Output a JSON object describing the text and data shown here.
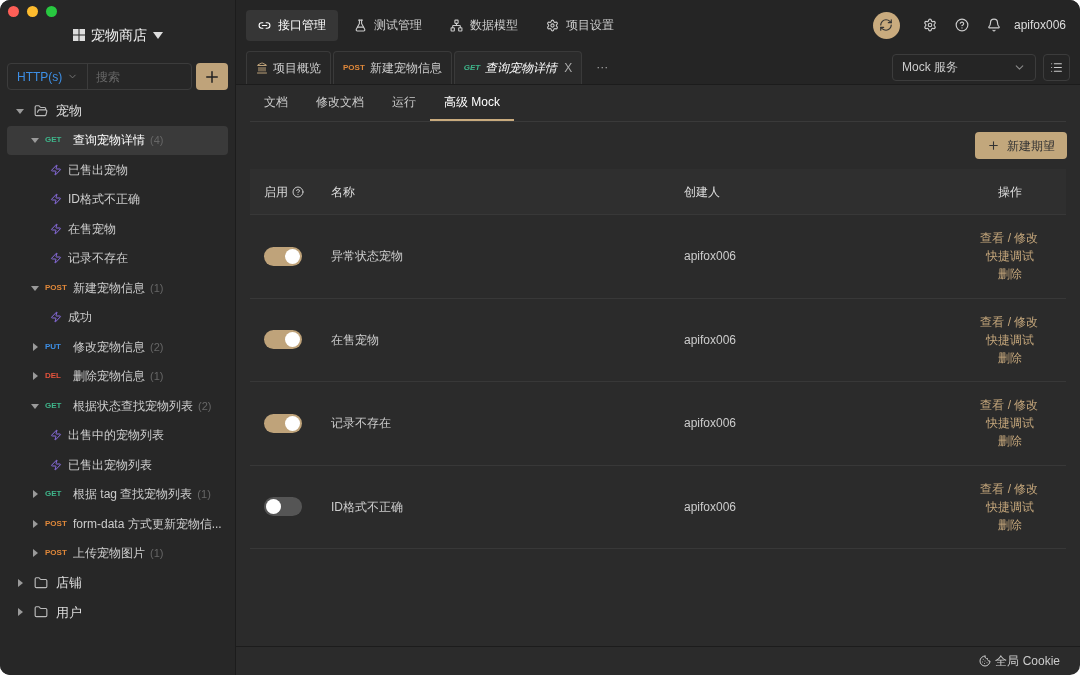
{
  "project": {
    "title": "宠物商店"
  },
  "sidebar": {
    "protocol": "HTTP(s)",
    "search": {
      "placeholder": "搜索"
    },
    "tree": [
      {
        "kind": "folder",
        "name": "宠物",
        "expanded": true,
        "children": [
          {
            "kind": "endpoint",
            "method": "GET",
            "name": "查询宠物详情",
            "count": "(4)",
            "expanded": true,
            "selected": true,
            "children": [
              {
                "kind": "mock",
                "name": "已售出宠物",
                "selected": false
              },
              {
                "kind": "mock",
                "name": "ID格式不正确",
                "selected": false
              },
              {
                "kind": "mock",
                "name": "在售宠物",
                "selected": false
              },
              {
                "kind": "mock",
                "name": "记录不存在",
                "selected": false
              }
            ]
          },
          {
            "kind": "endpoint",
            "method": "POST",
            "name": "新建宠物信息",
            "count": "(1)",
            "expanded": true,
            "selected": false,
            "children": [
              {
                "kind": "mock",
                "name": "成功",
                "selected": false
              }
            ]
          },
          {
            "kind": "endpoint",
            "method": "PUT",
            "name": "修改宠物信息",
            "count": "(2)",
            "expanded": false,
            "selected": false
          },
          {
            "kind": "endpoint",
            "method": "DEL",
            "name": "删除宠物信息",
            "count": "(1)",
            "expanded": false,
            "selected": false
          },
          {
            "kind": "endpoint",
            "method": "GET",
            "name": "根据状态查找宠物列表",
            "count": "(2)",
            "expanded": true,
            "selected": false,
            "children": [
              {
                "kind": "mock",
                "name": "出售中的宠物列表",
                "selected": false
              },
              {
                "kind": "mock",
                "name": "已售出宠物列表",
                "selected": false
              }
            ]
          },
          {
            "kind": "endpoint",
            "method": "GET",
            "name": "根据 tag 查找宠物列表",
            "count": "(1)",
            "expanded": false,
            "selected": false
          },
          {
            "kind": "endpoint",
            "method": "POST",
            "name": "form-data 方式更新宠物信...",
            "expanded": false,
            "selected": false
          },
          {
            "kind": "endpoint",
            "method": "POST",
            "name": "上传宠物图片",
            "count": "(1)",
            "expanded": false,
            "selected": false
          }
        ]
      },
      {
        "kind": "folder",
        "name": "店铺",
        "expanded": false
      },
      {
        "kind": "folder",
        "name": "用户",
        "expanded": false
      }
    ]
  },
  "nav": [
    {
      "label": "接口管理",
      "selected": true,
      "kind": "api"
    },
    {
      "label": "测试管理",
      "selected": false,
      "kind": "test"
    },
    {
      "label": "数据模型",
      "selected": false,
      "kind": "model"
    },
    {
      "label": "项目设置",
      "selected": false,
      "kind": "settings"
    }
  ],
  "user": "apifox006",
  "tabs": [
    {
      "kind": "overview",
      "label": "项目概览",
      "selected": false
    },
    {
      "kind": "endpoint",
      "method": "POST",
      "label": "新建宠物信息",
      "selected": false
    },
    {
      "kind": "endpoint",
      "method": "GET",
      "label": "查询宠物详情",
      "selected": true,
      "close": "X"
    }
  ],
  "more_tabs": "···",
  "env_select": "Mock 服务",
  "subtabs": [
    {
      "label": "文档",
      "selected": false
    },
    {
      "label": "修改文档",
      "selected": false
    },
    {
      "label": "运行",
      "selected": false
    },
    {
      "label": "高级 Mock",
      "selected": true
    }
  ],
  "new_button": "新建期望",
  "table": {
    "columns": [
      "启用",
      "名称",
      "创建人",
      "操作"
    ],
    "rows": [
      {
        "enabled": true,
        "name": "异常状态宠物",
        "creator": "apifox006",
        "actions": [
          "查看 / 修改",
          "快捷调试",
          "删除"
        ]
      },
      {
        "enabled": true,
        "name": "在售宠物",
        "creator": "apifox006",
        "actions": [
          "查看 / 修改",
          "快捷调试",
          "删除"
        ]
      },
      {
        "enabled": true,
        "name": "记录不存在",
        "creator": "apifox006",
        "actions": [
          "查看 / 修改",
          "快捷调试",
          "删除"
        ]
      },
      {
        "enabled": false,
        "name": "ID格式不正确",
        "creator": "apifox006",
        "actions": [
          "查看 / 修改",
          "快捷调试",
          "删除"
        ]
      }
    ]
  },
  "status_bar": {
    "cookie": "全局 Cookie"
  }
}
